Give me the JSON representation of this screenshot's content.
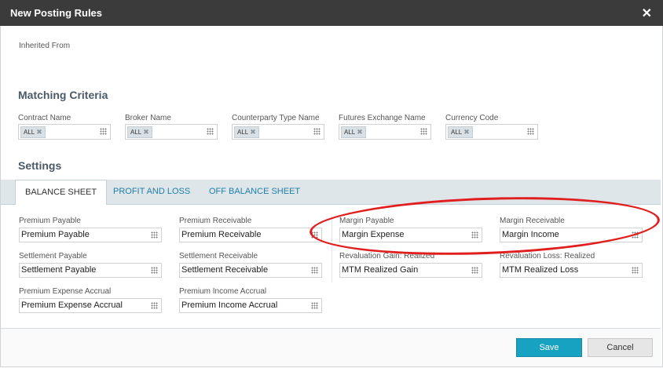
{
  "dialog": {
    "title": "New Posting Rules",
    "close_symbol": "✕"
  },
  "inherited_from_label": "Inherited From",
  "matching_criteria": {
    "title": "Matching Criteria",
    "fields": [
      {
        "label": "Contract Name",
        "chip": "ALL"
      },
      {
        "label": "Broker Name",
        "chip": "ALL"
      },
      {
        "label": "Counterparty Type Name",
        "chip": "ALL"
      },
      {
        "label": "Futures Exchange Name",
        "chip": "ALL"
      },
      {
        "label": "Currency Code",
        "chip": "ALL"
      }
    ]
  },
  "settings": {
    "title": "Settings",
    "tabs": [
      {
        "label": "BALANCE SHEET",
        "active": true
      },
      {
        "label": "PROFIT AND LOSS",
        "active": false
      },
      {
        "label": "OFF BALANCE SHEET",
        "active": false
      }
    ],
    "fields": {
      "premium_payable": {
        "label": "Premium Payable",
        "value": "Premium Payable"
      },
      "premium_receivable": {
        "label": "Premium Receivable",
        "value": "Premium Receivable"
      },
      "margin_payable": {
        "label": "Margin Payable",
        "value": "Margin Expense"
      },
      "margin_receivable": {
        "label": "Margin Receivable",
        "value": "Margin Income"
      },
      "settlement_payable": {
        "label": "Settlement Payable",
        "value": "Settlement Payable"
      },
      "settlement_receivable": {
        "label": "Settlement Receivable",
        "value": "Settlement Receivable"
      },
      "reval_gain_realized": {
        "label": "Revaluation Gain: Realized",
        "value": "MTM Realized Gain"
      },
      "reval_loss_realized": {
        "label": "Revaluation Loss: Realized",
        "value": "MTM Realized Loss"
      },
      "premium_expense_accrual": {
        "label": "Premium Expense Accrual",
        "value": "Premium Expense Accrual"
      },
      "premium_income_accrual": {
        "label": "Premium Income Accrual",
        "value": "Premium Income Accrual"
      }
    }
  },
  "buttons": {
    "save": "Save",
    "cancel": "Cancel"
  },
  "colors": {
    "accent": "#17a2c2",
    "annotation": "#e01e1e",
    "titlebar": "#3b3b3b"
  }
}
